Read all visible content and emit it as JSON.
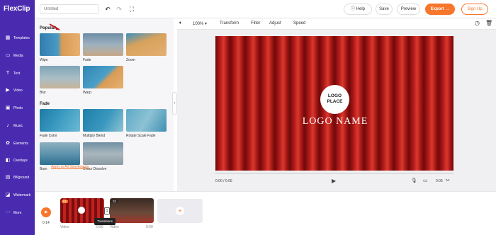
{
  "app": {
    "name": "FlexClip",
    "title_placeholder": "Untitled"
  },
  "topbar": {
    "help": "Help",
    "save": "Save",
    "preview": "Preview",
    "export": "Export",
    "signup": "Sign Up"
  },
  "sidebar": {
    "items": [
      {
        "label": "Templates",
        "icon": "templates-icon"
      },
      {
        "label": "Media",
        "icon": "media-icon"
      },
      {
        "label": "Text",
        "icon": "text-icon"
      },
      {
        "label": "Video",
        "icon": "video-icon"
      },
      {
        "label": "Photo",
        "icon": "photo-icon"
      },
      {
        "label": "Music",
        "icon": "music-icon"
      },
      {
        "label": "Elements",
        "icon": "elements-icon"
      },
      {
        "label": "Overlays",
        "icon": "overlays-icon"
      },
      {
        "label": "BKground",
        "icon": "background-icon"
      },
      {
        "label": "Watermark",
        "icon": "watermark-icon"
      },
      {
        "label": "More",
        "icon": "more-icon"
      }
    ]
  },
  "panel": {
    "popular_title": "Popular",
    "fade_title": "Fade",
    "popular": [
      "Wipe",
      "Fade",
      "Zoom",
      "Blur",
      "Warp"
    ],
    "fade": [
      "Fade Color",
      "Multiply Blend",
      "Rotate Scale Fade",
      "Burn",
      "Cross Dissolve"
    ],
    "apply_all": "Apply to All Storyboards"
  },
  "edit_toolbar": {
    "zoom": "100%",
    "transform": "Transform",
    "filter": "Filter",
    "adjust": "Adjust",
    "speed": "Speed"
  },
  "stage": {
    "logo_line1": "LOGO",
    "logo_line2": "PLACE",
    "logo_name": "LOGO NAME",
    "time_current": "0:00 / 0:05",
    "duration": "0:05"
  },
  "timeline": {
    "total_time": "0:14",
    "clips": [
      {
        "badge": "01",
        "type": "Video",
        "duration": "0:05"
      },
      {
        "badge": "02",
        "type": "Video",
        "duration": "0:09"
      }
    ],
    "transition_index": "1",
    "tooltip": "Transitions"
  },
  "colors": {
    "sidebar": "#4a2bb0",
    "accent": "#f6762c",
    "arrow": "#c0141b"
  }
}
